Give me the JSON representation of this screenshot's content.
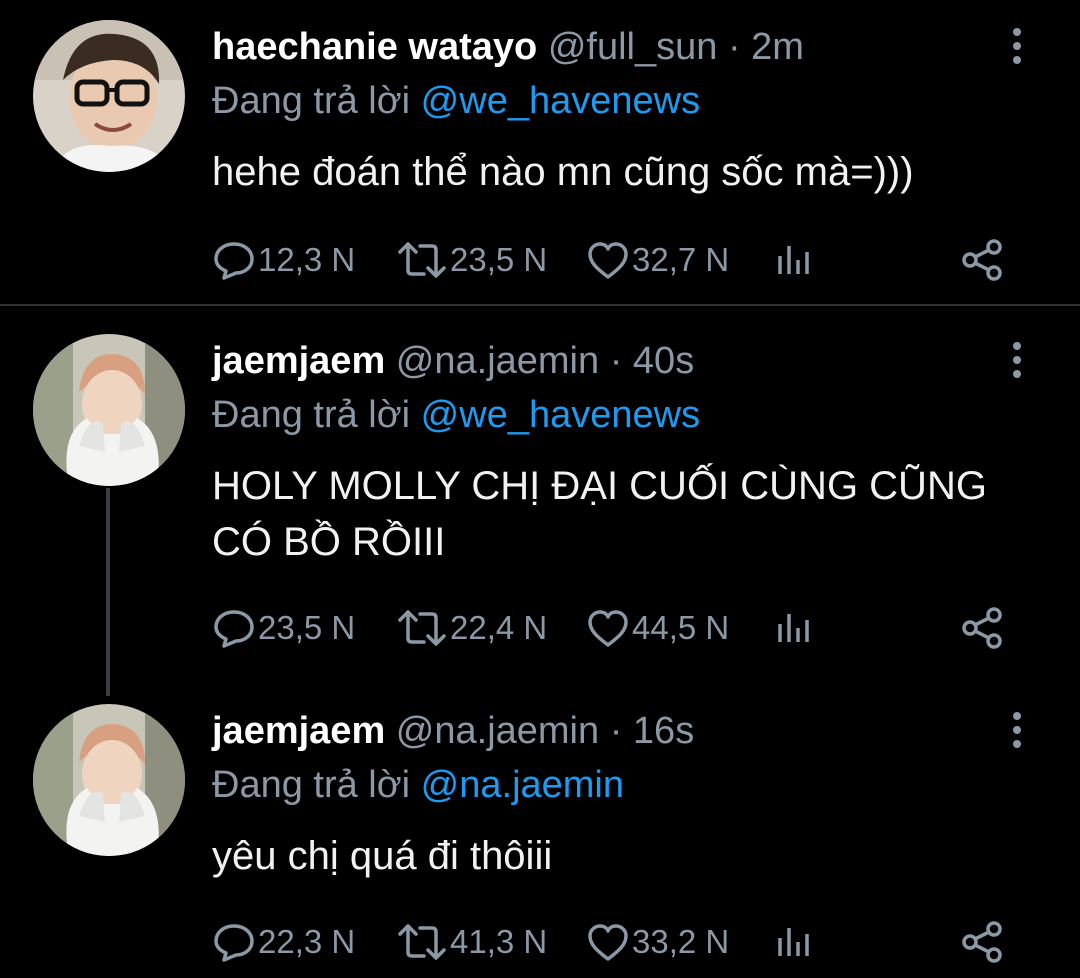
{
  "tweets": [
    {
      "name": "haechanie watayo",
      "handle": "@full_sun",
      "time": "2m",
      "reply_prefix": "Đang trả lời",
      "reply_to": "@we_havenews",
      "text": "hehe đoán thể nào mn cũng sốc mà=)))",
      "replies": "12,3 N",
      "retweets": "23,5 N",
      "likes": "32,7 N"
    },
    {
      "name": "jaemjaem",
      "handle": "@na.jaemin",
      "time": "40s",
      "reply_prefix": "Đang trả lời",
      "reply_to": "@we_havenews",
      "text": "HOLY MOLLY CHỊ ĐẠI CUỐI CÙNG CŨNG CÓ BỒ RỒIII",
      "replies": "23,5 N",
      "retweets": "22,4 N",
      "likes": "44,5 N"
    },
    {
      "name": "jaemjaem",
      "handle": "@na.jaemin",
      "time": "16s",
      "reply_prefix": "Đang trả lời",
      "reply_to": "@na.jaemin",
      "text": "yêu chị quá đi thôiii",
      "replies": "22,3 N",
      "retweets": "41,3 N",
      "likes": "33,2 N"
    }
  ],
  "icons": {
    "reply": "reply-icon",
    "retweet": "retweet-icon",
    "like": "heart-icon",
    "analytics": "analytics-icon",
    "share": "share-icon",
    "menu": "more-vertical-icon"
  },
  "colors": {
    "background": "#000000",
    "secondary_text": "#8b98a5",
    "mention": "#1d9bf0",
    "divider": "#2f3336"
  }
}
